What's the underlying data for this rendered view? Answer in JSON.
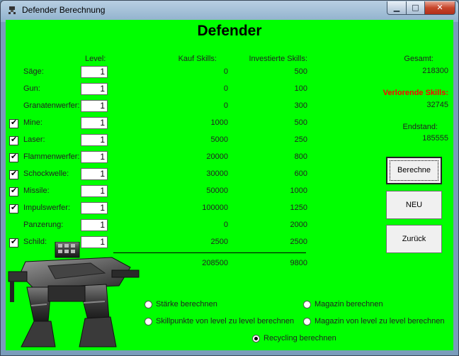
{
  "window": {
    "title": "Defender Berechnung",
    "min_glyph": "▁",
    "max_glyph": "□",
    "close_glyph": "✕"
  },
  "heading": "Defender",
  "columns": {
    "level": "Level:",
    "kauf": "Kauf Skills:",
    "investiert": "Investierte Skills:"
  },
  "rows": [
    {
      "label": "Säge:",
      "checked": false,
      "level": "1",
      "kauf": "0",
      "inv": "500"
    },
    {
      "label": "Gun:",
      "checked": false,
      "level": "1",
      "kauf": "0",
      "inv": "100"
    },
    {
      "label": "Granatenwerfer:",
      "checked": false,
      "level": "1",
      "kauf": "0",
      "inv": "300"
    },
    {
      "label": "Mine:",
      "checked": true,
      "level": "1",
      "kauf": "1000",
      "inv": "500"
    },
    {
      "label": "Laser:",
      "checked": true,
      "level": "1",
      "kauf": "5000",
      "inv": "250"
    },
    {
      "label": "Flammenwerfer:",
      "checked": true,
      "level": "1",
      "kauf": "20000",
      "inv": "800"
    },
    {
      "label": "Schockwelle:",
      "checked": true,
      "level": "1",
      "kauf": "30000",
      "inv": "600"
    },
    {
      "label": "Missile:",
      "checked": true,
      "level": "1",
      "kauf": "50000",
      "inv": "1000"
    },
    {
      "label": "Impulswerfer:",
      "checked": true,
      "level": "1",
      "kauf": "100000",
      "inv": "1250"
    },
    {
      "label": "Panzerung:",
      "checked": false,
      "level": "1",
      "kauf": "0",
      "inv": "2000"
    },
    {
      "label": "Schild:",
      "checked": true,
      "level": "1",
      "kauf": "2500",
      "inv": "2500"
    }
  ],
  "totals": {
    "kauf": "208500",
    "inv": "9800"
  },
  "summary": {
    "gesamt_label": "Gesamt:",
    "gesamt_value": "218300",
    "verlorene_label": "Verlorende Skills:",
    "verlorene_value": "32745",
    "endstand_label": "Endstand:",
    "endstand_value": "185555",
    "verlorene_color": "#ff0000"
  },
  "buttons": {
    "berechne": "Berechne",
    "neu": "NEU",
    "zurueck": "Zurück"
  },
  "radios": [
    {
      "label": "Stärke berechnen",
      "selected": false
    },
    {
      "label": "Skillpunkte von level zu level berechnen",
      "selected": false
    },
    {
      "label": "Magazin berechnen",
      "selected": false
    },
    {
      "label": "Magazin von level zu level berechnen",
      "selected": false
    },
    {
      "label": "Recycling berechnen",
      "selected": true
    }
  ],
  "colors": {
    "client_bg": "#00ff00"
  }
}
